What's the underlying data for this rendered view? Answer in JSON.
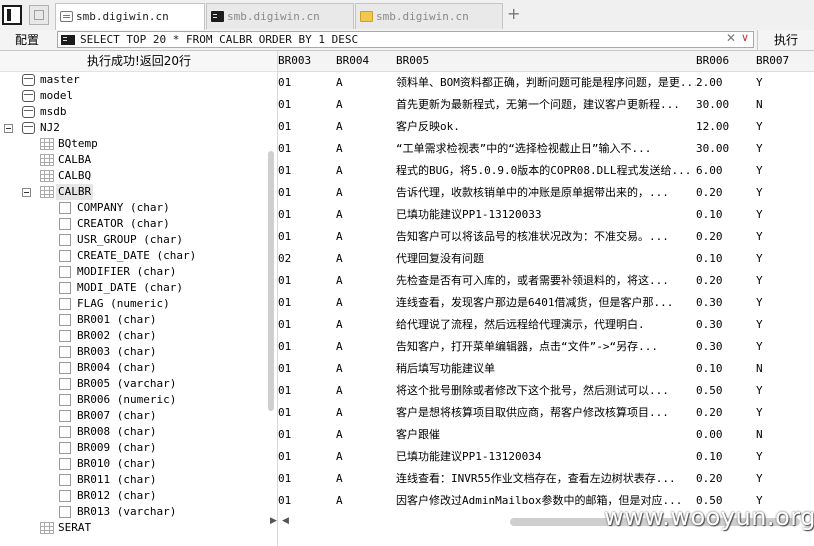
{
  "tabs": [
    {
      "label": "smb.digiwin.cn",
      "icon": "database-icon",
      "active": true
    },
    {
      "label": "smb.digiwin.cn",
      "icon": "terminal-icon",
      "active": false
    },
    {
      "label": "smb.digiwin.cn",
      "icon": "folder-icon",
      "active": false
    }
  ],
  "new_tab_label": "+",
  "toolbar": {
    "config_label": "配置",
    "sql": "SELECT TOP 20 * FROM CALBR ORDER BY 1 DESC",
    "clear_glyph": "✕",
    "dropdown_glyph": "∨",
    "run_label": "执行"
  },
  "status": "执行成功!返回20行",
  "tree": {
    "databases": [
      "master",
      "model",
      "msdb"
    ],
    "nj2": "NJ2",
    "tables": [
      "BQtemp",
      "CALBA",
      "CALBQ"
    ],
    "selected_table": "CALBR",
    "columns": [
      "COMPANY (char)",
      "CREATOR (char)",
      "USR_GROUP (char)",
      "CREATE_DATE (char)",
      "MODIFIER (char)",
      "MODI_DATE (char)",
      "FLAG (numeric)",
      "BR001 (char)",
      "BR002 (char)",
      "BR003 (char)",
      "BR004 (char)",
      "BR005 (varchar)",
      "BR006 (numeric)",
      "BR007 (char)",
      "BR008 (char)",
      "BR009 (char)",
      "BR010 (char)",
      "BR011 (char)",
      "BR012 (char)",
      "BR013 (varchar)"
    ],
    "partial_next": "SERAT"
  },
  "grid": {
    "headers": [
      "BR003",
      "BR004",
      "BR005",
      "BR006",
      "BR007"
    ],
    "rows": [
      [
        "01",
        "A",
        "领料单、BOM资料都正确，判断问题可能是程序问题，是更...",
        "2.00",
        "Y"
      ],
      [
        "01",
        "A",
        "首先更新为最新程式，无第一个问题，建议客户更新程...",
        "30.00",
        "N"
      ],
      [
        "01",
        "A",
        "客户反映ok.",
        "12.00",
        "Y"
      ],
      [
        "01",
        "A",
        "“工单需求检视表”中的“选择检视截止日”输入不...",
        "30.00",
        "Y"
      ],
      [
        "01",
        "A",
        "程式的BUG，将5.0.9.0版本的COPR08.DLL程式发送给...",
        "6.00",
        "Y"
      ],
      [
        "01",
        "A",
        "告诉代理，收款核销单中的冲账是原单据带出来的，...",
        "0.20",
        "Y"
      ],
      [
        "01",
        "A",
        "已填功能建议PP1-13120033",
        "0.10",
        "Y"
      ],
      [
        "01",
        "A",
        "告知客户可以将该品号的核准状况改为：不准交易。...",
        "0.20",
        "Y"
      ],
      [
        "02",
        "A",
        "代理回复没有问题",
        "0.10",
        "Y"
      ],
      [
        "01",
        "A",
        "先检查是否有可入库的，或者需要补领退料的，将这...",
        "0.20",
        "Y"
      ],
      [
        "01",
        "A",
        "连线查看，发现客户那边是6401借减货，但是客户那...",
        "0.30",
        "Y"
      ],
      [
        "01",
        "A",
        "给代理说了流程，然后远程给代理演示，代理明白.",
        "0.30",
        "Y"
      ],
      [
        "01",
        "A",
        "告知客户，打开菜单编辑器，点击“文件”->“另存...",
        "0.30",
        "Y"
      ],
      [
        "01",
        "A",
        "稍后填写功能建议单",
        "0.10",
        "N"
      ],
      [
        "01",
        "A",
        "将这个批号删除或者修改下这个批号，然后测试可以...",
        "0.50",
        "Y"
      ],
      [
        "01",
        "A",
        "客户是想将核算项目取供应商，帮客户修改核算项目...",
        "0.20",
        "Y"
      ],
      [
        "01",
        "A",
        "客户跟催",
        "0.00",
        "N"
      ],
      [
        "01",
        "A",
        "已填功能建议PP1-13120034",
        "0.10",
        "Y"
      ],
      [
        "01",
        "A",
        "连线查看：INVR55作业文档存在，查看左边树状表存...",
        "0.20",
        "Y"
      ],
      [
        "01",
        "A",
        "因客户修改过AdminMailbox参数中的邮箱，但是对应...",
        "0.50",
        "Y"
      ]
    ]
  },
  "scroll_arrows": {
    "left": "◀",
    "right": "▶"
  },
  "watermark": "www.wooyun.org"
}
